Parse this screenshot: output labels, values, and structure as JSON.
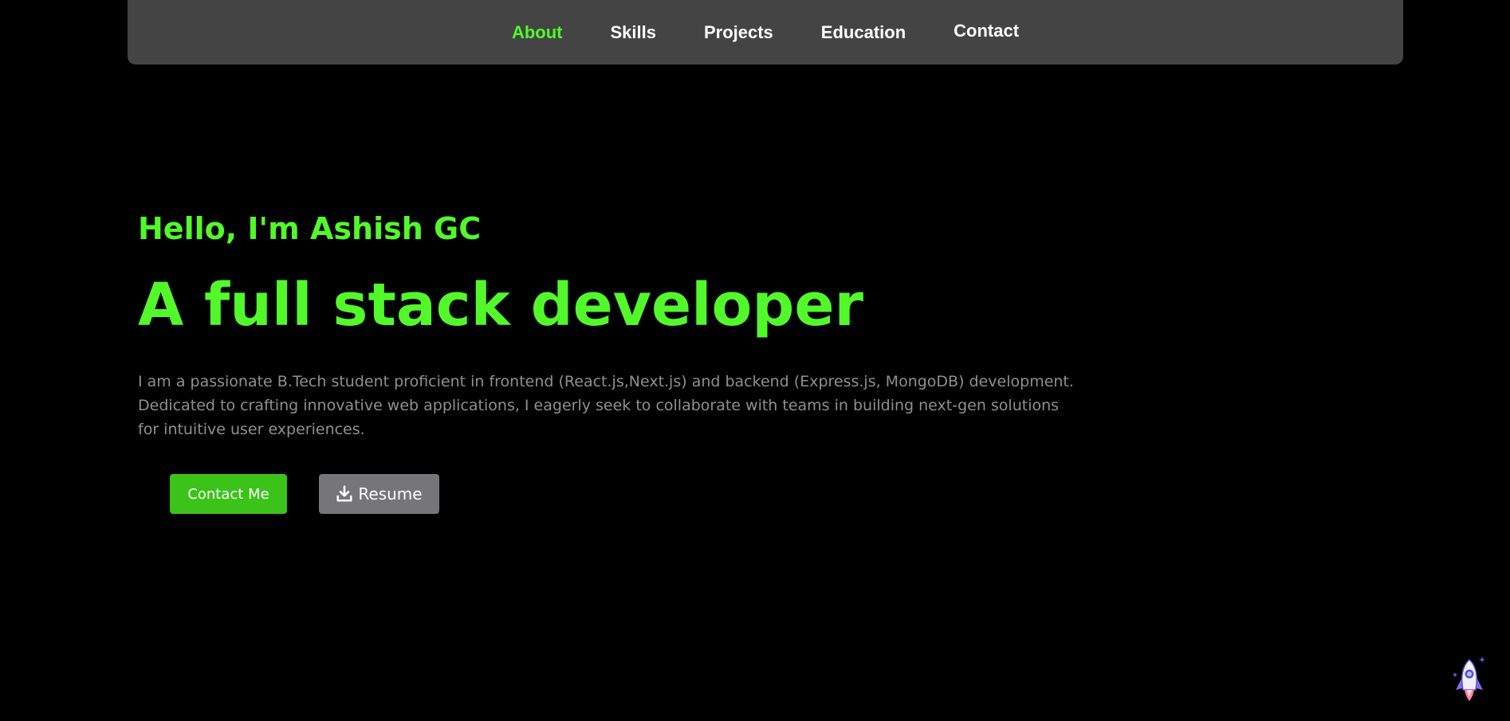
{
  "nav": {
    "items": [
      {
        "label": "About",
        "active": true
      },
      {
        "label": "Skills",
        "active": false
      },
      {
        "label": "Projects",
        "active": false
      },
      {
        "label": "Education",
        "active": false
      },
      {
        "label": "Contact",
        "active": false
      }
    ]
  },
  "hero": {
    "greeting": "Hello, I'm Ashish GC",
    "headline": "A full stack developer",
    "bio": "I am a passionate B.Tech student proficient in frontend (React.js,Next.js) and backend (Express.js, MongoDB) development. Dedicated to crafting innovative web applications, I eagerly seek to collaborate with teams in building next-gen solutions for intuitive user experiences.",
    "contact_button": "Contact Me",
    "resume_button": "Resume",
    "resume_icon": "download-icon"
  },
  "scroll_top_icon": "rocket-icon",
  "colors": {
    "accent": "#52f82a",
    "button_green": "#3bc31a",
    "button_gray": "#767579",
    "navbar_bg": "#444444",
    "page_bg": "#000000",
    "bio_text": "#8f8f8f"
  }
}
